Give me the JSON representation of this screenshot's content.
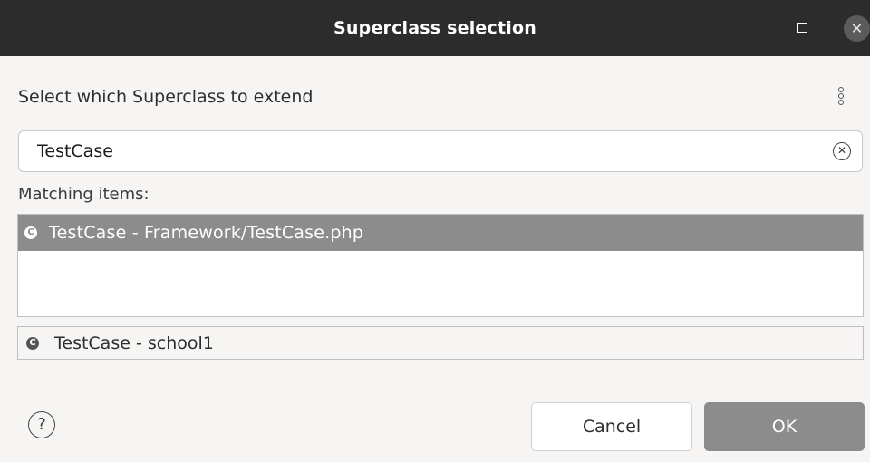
{
  "window": {
    "title": "Superclass selection",
    "maximize_icon": "maximize-icon",
    "close_icon": "close-icon"
  },
  "prompt": "Select which Superclass to extend",
  "menu_icon": "vertical-ellipsis-icon",
  "search": {
    "value": "TestCase",
    "clear_icon": "clear-icon"
  },
  "matching_label": "Matching items:",
  "items": [
    {
      "label": "TestCase - Framework/TestCase.php",
      "icon": "class-icon",
      "selected": true
    }
  ],
  "detail": {
    "label": "TestCase - school1",
    "icon": "class-icon"
  },
  "buttons": {
    "help_icon": "help-icon",
    "cancel": "Cancel",
    "ok": "OK"
  },
  "colors": {
    "titlebar": "#2c2c2c",
    "selection": "#8c8c8c",
    "background": "#f6f5f4"
  }
}
